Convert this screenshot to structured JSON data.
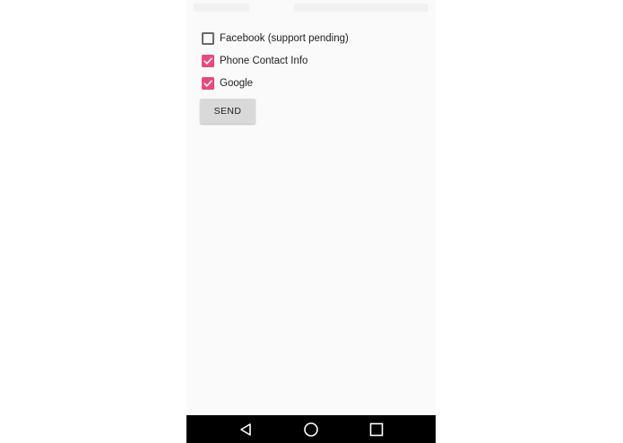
{
  "options": [
    {
      "label": "Facebook (support pending)",
      "checked": false
    },
    {
      "label": "Phone Contact Info",
      "checked": true
    },
    {
      "label": "Google",
      "checked": true
    }
  ],
  "send_button": {
    "label": "SEND"
  },
  "nav_bar": {
    "back_icon": "back-triangle-icon",
    "home_icon": "home-circle-icon",
    "recents_icon": "recents-square-icon"
  },
  "colors": {
    "accent": "#e9497a",
    "background": "#fafafa",
    "nav_bar": "#000000",
    "button": "#d9d9d9"
  }
}
